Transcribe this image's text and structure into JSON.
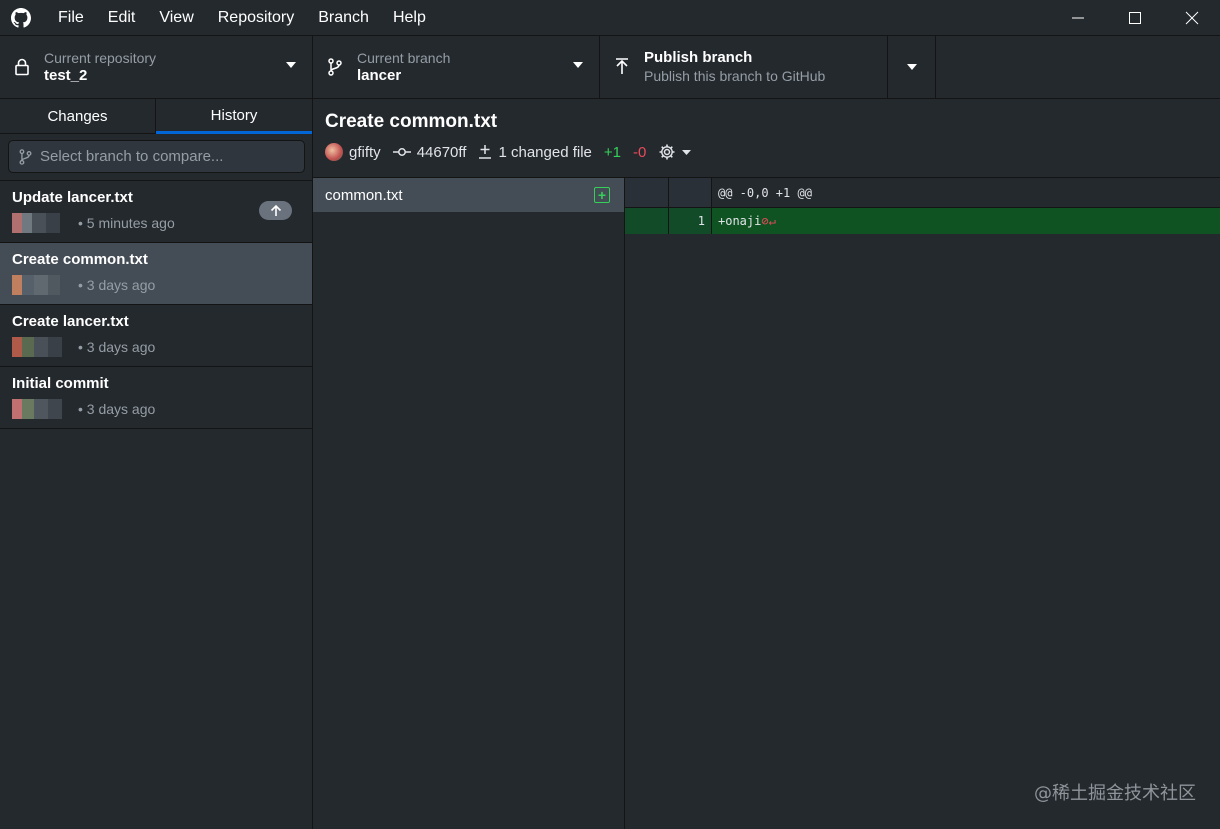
{
  "menu": [
    "File",
    "Edit",
    "View",
    "Repository",
    "Branch",
    "Help"
  ],
  "toolbar": {
    "repo_label": "Current repository",
    "repo_value": "test_2",
    "branch_label": "Current branch",
    "branch_value": "lancer",
    "publish_title": "Publish branch",
    "publish_subtitle": "Publish this branch to GitHub"
  },
  "sidebar": {
    "tabs": [
      "Changes",
      "History"
    ],
    "compare_placeholder": "Select branch to compare...",
    "commits": [
      {
        "title": "Update lancer.txt",
        "time": "• 5 minutes ago",
        "unpushed": true
      },
      {
        "title": "Create common.txt",
        "time": "• 3 days ago",
        "unpushed": false
      },
      {
        "title": "Create lancer.txt",
        "time": "• 3 days ago",
        "unpushed": false
      },
      {
        "title": "Initial commit",
        "time": "• 3 days ago",
        "unpushed": false
      }
    ]
  },
  "commit_detail": {
    "title": "Create common.txt",
    "author": "gfifty",
    "sha": "44670ff",
    "changed_files": "1 changed file",
    "additions": "+1",
    "deletions": "-0",
    "files": [
      {
        "name": "common.txt",
        "status": "added"
      }
    ]
  },
  "diff": {
    "hunk_header": "@@ -0,0 +1 @@",
    "lines": [
      {
        "new_line": "1",
        "text": "+onaji"
      }
    ]
  },
  "watermark": "@稀土掘金技术社区",
  "colors": {
    "accent": "#0366d6",
    "added": "#34d058",
    "removed": "#ea4a5a"
  }
}
